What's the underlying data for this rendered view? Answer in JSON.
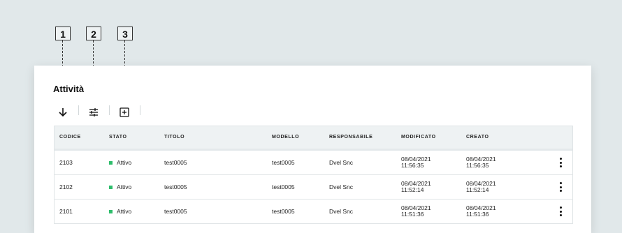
{
  "callouts": [
    "1",
    "2",
    "3"
  ],
  "panel": {
    "title": "Attività"
  },
  "toolbar": {
    "icons": [
      "arrow-down-icon",
      "sliders-icon",
      "add-box-icon"
    ]
  },
  "table": {
    "headers": [
      "CODICE",
      "STATO",
      "TITOLO",
      "MODELLO",
      "RESPONSABILE",
      "MODIFICATO",
      "CREATO"
    ],
    "rows": [
      {
        "codice": "2103",
        "stato": "Attivo",
        "titolo": "test0005",
        "modello": "test0005",
        "responsabile": "Dvel Snc",
        "modificato_date": "08/04/2021",
        "modificato_time": "11:56:35",
        "creato_date": "08/04/2021",
        "creato_time": "11:56:35"
      },
      {
        "codice": "2102",
        "stato": "Attivo",
        "titolo": "test0005",
        "modello": "test0005",
        "responsabile": "Dvel Snc",
        "modificato_date": "08/04/2021",
        "modificato_time": "11:52:14",
        "creato_date": "08/04/2021",
        "creato_time": "11:52:14"
      },
      {
        "codice": "2101",
        "stato": "Attivo",
        "titolo": "test0005",
        "modello": "test0005",
        "responsabile": "Dvel Snc",
        "modificato_date": "08/04/2021",
        "modificato_time": "11:51:36",
        "creato_date": "08/04/2021",
        "creato_time": "11:51:36"
      }
    ]
  },
  "colors": {
    "background": "#e1e8ea",
    "status_active": "#2ebd6b",
    "header_bg": "#eef2f3"
  }
}
